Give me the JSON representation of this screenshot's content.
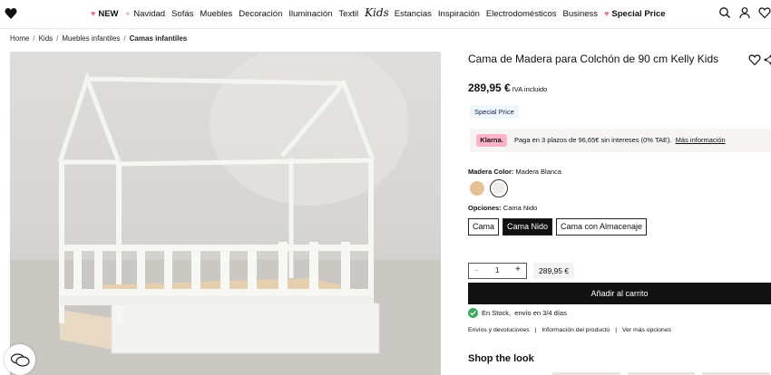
{
  "header": {
    "nav": [
      {
        "label": "NEW",
        "bold": true,
        "icon": "heart"
      },
      {
        "label": "Navidad",
        "icon": "star"
      },
      {
        "label": "Sofás"
      },
      {
        "label": "Muebles"
      },
      {
        "label": "Decoración"
      },
      {
        "label": "Iluminación"
      },
      {
        "label": "Textil"
      },
      {
        "label": "Kids",
        "logo": true
      },
      {
        "label": "Estancias"
      },
      {
        "label": "Inspiración"
      },
      {
        "label": "Electrodomésticos"
      },
      {
        "label": "Business"
      },
      {
        "label": "Special Price",
        "bold": true,
        "icon": "heart"
      }
    ],
    "icons": [
      "search-icon",
      "user-icon",
      "heart-icon"
    ]
  },
  "breadcrumb": [
    "Home",
    "Kids",
    "Muebles infantiles",
    "Camas infantiles"
  ],
  "product": {
    "title": "Cama de Madera para Colchón de 90 cm Kelly Kids",
    "price": "289,95 €",
    "price_note": "IVA incluido",
    "badge": "Special Price",
    "klarna": {
      "logo": "Klarna.",
      "text": "Paga en 3 plazos de 96,65€ sin intereses (0% TAE).",
      "link": "Más información"
    },
    "color_label": "Madera Color:",
    "color_value": "Madera Blanca",
    "swatch_colors": [
      "#e5c193",
      "#f1ecea"
    ],
    "options_label": "Opciones:",
    "options_value": "Cama Nido",
    "options": [
      {
        "label": "Cama",
        "selected": false
      },
      {
        "label": "Cama Nido",
        "selected": true
      },
      {
        "label": "Cama con Almacenaje",
        "selected": false
      }
    ],
    "quantity": "1",
    "qty_minus": "−",
    "qty_plus": "+",
    "qty_price": "289,95 €",
    "cart_button": "Añadir al carrito",
    "stock": "En Stock,",
    "delivery": "envío en 3/4 días",
    "links": [
      "Envíos y devoluciones",
      "Información del producto",
      "Ver más opciones"
    ],
    "shop_the_look": "Shop the look"
  },
  "colors": {
    "accent": "#111111",
    "heart": "#e36b8e",
    "klarna": "#ffb3c7",
    "stock": "#3fa862"
  }
}
